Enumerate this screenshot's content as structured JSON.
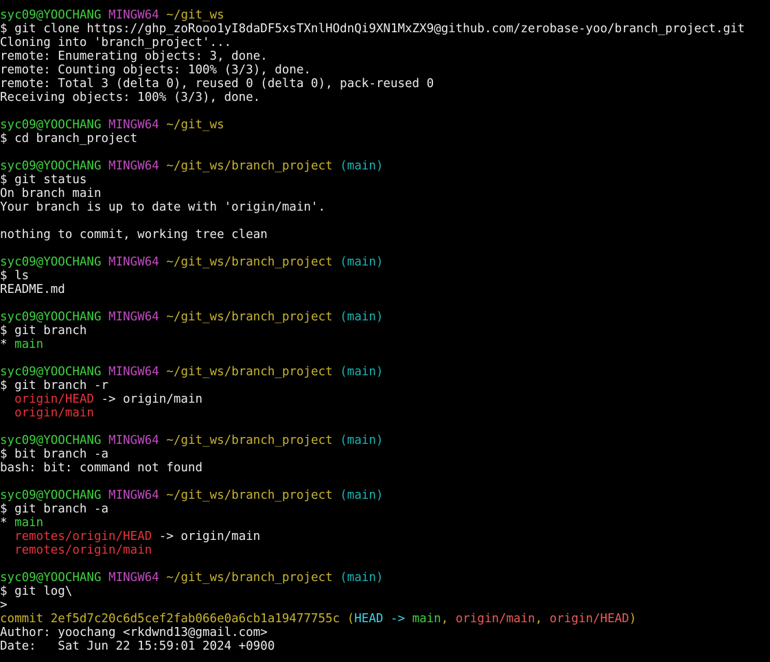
{
  "colors": {
    "text": "#ececec",
    "user": "#3fd23f",
    "msys": "#c24bc2",
    "path": "#c9b52e",
    "branch": "#19b4b4",
    "remote": "#e8333c",
    "localbranch": "#3fd23f",
    "commit": "#c9b52e",
    "head": "#3bd8e8",
    "refgreen": "#3fd23f",
    "refred": "#ef5a5a",
    "refparen": "#c9b52e"
  },
  "lines": [
    [
      {
        "t": "syc09@YOOCHANG",
        "c": "user"
      },
      {
        "t": " ",
        "c": "text"
      },
      {
        "t": "MINGW64",
        "c": "msys"
      },
      {
        "t": " ",
        "c": "text"
      },
      {
        "t": "~/git_ws",
        "c": "path"
      }
    ],
    [
      {
        "t": "$ git clone https://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@github.com/zerobase-yoo/branch_project.git",
        "c": "text"
      }
    ],
    [
      {
        "t": "Cloning into 'branch_project'...",
        "c": "text"
      }
    ],
    [
      {
        "t": "remote: Enumerating objects: 3, done.",
        "c": "text"
      }
    ],
    [
      {
        "t": "remote: Counting objects: 100% (3/3), done.",
        "c": "text"
      }
    ],
    [
      {
        "t": "remote: Total 3 (delta 0), reused 0 (delta 0), pack-reused 0",
        "c": "text"
      }
    ],
    [
      {
        "t": "Receiving objects: 100% (3/3), done.",
        "c": "text"
      }
    ],
    [],
    [
      {
        "t": "syc09@YOOCHANG",
        "c": "user"
      },
      {
        "t": " ",
        "c": "text"
      },
      {
        "t": "MINGW64",
        "c": "msys"
      },
      {
        "t": " ",
        "c": "text"
      },
      {
        "t": "~/git_ws",
        "c": "path"
      }
    ],
    [
      {
        "t": "$ cd branch_project",
        "c": "text"
      }
    ],
    [],
    [
      {
        "t": "syc09@YOOCHANG",
        "c": "user"
      },
      {
        "t": " ",
        "c": "text"
      },
      {
        "t": "MINGW64",
        "c": "msys"
      },
      {
        "t": " ",
        "c": "text"
      },
      {
        "t": "~/git_ws/branch_project",
        "c": "path"
      },
      {
        "t": " ",
        "c": "text"
      },
      {
        "t": "(main)",
        "c": "branch"
      }
    ],
    [
      {
        "t": "$ git status",
        "c": "text"
      }
    ],
    [
      {
        "t": "On branch main",
        "c": "text"
      }
    ],
    [
      {
        "t": "Your branch is up to date with 'origin/main'.",
        "c": "text"
      }
    ],
    [],
    [
      {
        "t": "nothing to commit, working tree clean",
        "c": "text"
      }
    ],
    [],
    [
      {
        "t": "syc09@YOOCHANG",
        "c": "user"
      },
      {
        "t": " ",
        "c": "text"
      },
      {
        "t": "MINGW64",
        "c": "msys"
      },
      {
        "t": " ",
        "c": "text"
      },
      {
        "t": "~/git_ws/branch_project",
        "c": "path"
      },
      {
        "t": " ",
        "c": "text"
      },
      {
        "t": "(main)",
        "c": "branch"
      }
    ],
    [
      {
        "t": "$ ls",
        "c": "text"
      }
    ],
    [
      {
        "t": "README.md",
        "c": "text"
      }
    ],
    [],
    [
      {
        "t": "syc09@YOOCHANG",
        "c": "user"
      },
      {
        "t": " ",
        "c": "text"
      },
      {
        "t": "MINGW64",
        "c": "msys"
      },
      {
        "t": " ",
        "c": "text"
      },
      {
        "t": "~/git_ws/branch_project",
        "c": "path"
      },
      {
        "t": " ",
        "c": "text"
      },
      {
        "t": "(main)",
        "c": "branch"
      }
    ],
    [
      {
        "t": "$ git branch",
        "c": "text"
      }
    ],
    [
      {
        "t": "* ",
        "c": "text"
      },
      {
        "t": "main",
        "c": "localbranch"
      }
    ],
    [],
    [
      {
        "t": "syc09@YOOCHANG",
        "c": "user"
      },
      {
        "t": " ",
        "c": "text"
      },
      {
        "t": "MINGW64",
        "c": "msys"
      },
      {
        "t": " ",
        "c": "text"
      },
      {
        "t": "~/git_ws/branch_project",
        "c": "path"
      },
      {
        "t": " ",
        "c": "text"
      },
      {
        "t": "(main)",
        "c": "branch"
      }
    ],
    [
      {
        "t": "$ git branch -r",
        "c": "text"
      }
    ],
    [
      {
        "t": "  ",
        "c": "text"
      },
      {
        "t": "origin/HEAD",
        "c": "remote"
      },
      {
        "t": " -> origin/main",
        "c": "text"
      }
    ],
    [
      {
        "t": "  ",
        "c": "text"
      },
      {
        "t": "origin/main",
        "c": "remote"
      }
    ],
    [],
    [
      {
        "t": "syc09@YOOCHANG",
        "c": "user"
      },
      {
        "t": " ",
        "c": "text"
      },
      {
        "t": "MINGW64",
        "c": "msys"
      },
      {
        "t": " ",
        "c": "text"
      },
      {
        "t": "~/git_ws/branch_project",
        "c": "path"
      },
      {
        "t": " ",
        "c": "text"
      },
      {
        "t": "(main)",
        "c": "branch"
      }
    ],
    [
      {
        "t": "$ bit branch -a",
        "c": "text"
      }
    ],
    [
      {
        "t": "bash: bit: command not found",
        "c": "text"
      }
    ],
    [],
    [
      {
        "t": "syc09@YOOCHANG",
        "c": "user"
      },
      {
        "t": " ",
        "c": "text"
      },
      {
        "t": "MINGW64",
        "c": "msys"
      },
      {
        "t": " ",
        "c": "text"
      },
      {
        "t": "~/git_ws/branch_project",
        "c": "path"
      },
      {
        "t": " ",
        "c": "text"
      },
      {
        "t": "(main)",
        "c": "branch"
      }
    ],
    [
      {
        "t": "$ git branch -a",
        "c": "text"
      }
    ],
    [
      {
        "t": "* ",
        "c": "text"
      },
      {
        "t": "main",
        "c": "localbranch"
      }
    ],
    [
      {
        "t": "  ",
        "c": "text"
      },
      {
        "t": "remotes/origin/HEAD",
        "c": "remote"
      },
      {
        "t": " -> origin/main",
        "c": "text"
      }
    ],
    [
      {
        "t": "  ",
        "c": "text"
      },
      {
        "t": "remotes/origin/main",
        "c": "remote"
      }
    ],
    [],
    [
      {
        "t": "syc09@YOOCHANG",
        "c": "user"
      },
      {
        "t": " ",
        "c": "text"
      },
      {
        "t": "MINGW64",
        "c": "msys"
      },
      {
        "t": " ",
        "c": "text"
      },
      {
        "t": "~/git_ws/branch_project",
        "c": "path"
      },
      {
        "t": " ",
        "c": "text"
      },
      {
        "t": "(main)",
        "c": "branch"
      }
    ],
    [
      {
        "t": "$ git log\\",
        "c": "text"
      }
    ],
    [
      {
        "t": ">",
        "c": "text"
      }
    ],
    [
      {
        "t": "commit 2ef5d7c20c6d5cef2fab066e0a6cb1a19477755c",
        "c": "commit"
      },
      {
        "t": " (",
        "c": "refparen"
      },
      {
        "t": "HEAD ->",
        "c": "head"
      },
      {
        "t": " ",
        "c": "text"
      },
      {
        "t": "main",
        "c": "refgreen"
      },
      {
        "t": ", ",
        "c": "refparen"
      },
      {
        "t": "origin/main",
        "c": "refred"
      },
      {
        "t": ", ",
        "c": "refparen"
      },
      {
        "t": "origin/HEAD",
        "c": "refred"
      },
      {
        "t": ")",
        "c": "refparen"
      }
    ],
    [
      {
        "t": "Author: yoochang <rkdwnd13@gmail.com>",
        "c": "text"
      }
    ],
    [
      {
        "t": "Date:   Sat Jun 22 15:59:01 2024 +0900",
        "c": "text"
      }
    ]
  ]
}
